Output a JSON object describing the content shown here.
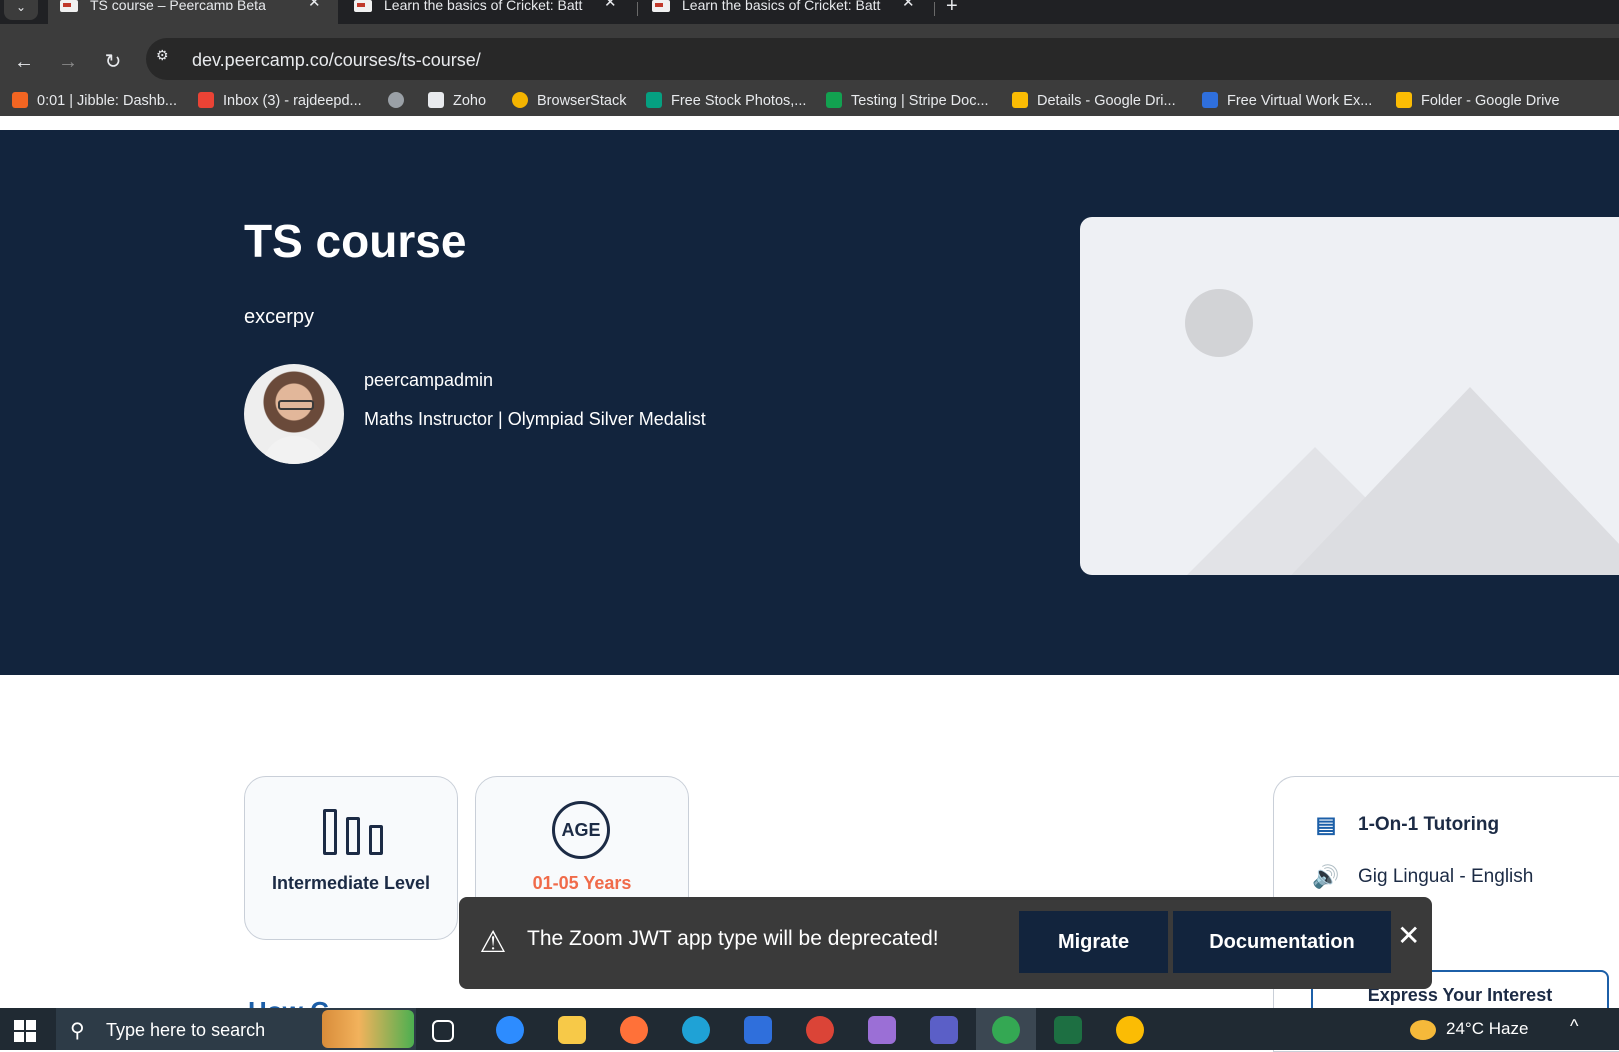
{
  "browser": {
    "tabs": [
      {
        "title": "TS course – Peercamp Beta",
        "active": true
      },
      {
        "title": "Learn the basics of Cricket: Batt",
        "active": false
      },
      {
        "title": "Learn the basics of Cricket: Batt",
        "active": false
      }
    ],
    "url": "dev.peercamp.co/courses/ts-course/",
    "bookmarks": [
      {
        "label": "0:01 | Jibble: Dashb...",
        "icon": "jibble-icon",
        "color": "#f26522"
      },
      {
        "label": "Inbox (3) - rajdeepd...",
        "icon": "gmail-icon",
        "color": "#ea4335"
      },
      {
        "label": "",
        "icon": "globe-icon",
        "color": "#9aa0a6"
      },
      {
        "label": "Zoho",
        "icon": "zoho-icon",
        "color": "#e8eaed"
      },
      {
        "label": "BrowserStack",
        "icon": "browserstack-icon",
        "color": "#f4b400"
      },
      {
        "label": "Free Stock Photos,...",
        "icon": "pexels-icon",
        "color": "#05a081"
      },
      {
        "label": "Testing | Stripe Doc...",
        "icon": "stripe-icon",
        "color": "#12a150"
      },
      {
        "label": "Details - Google Dri...",
        "icon": "google-drive-icon",
        "color": "#fbbc04"
      },
      {
        "label": "Free Virtual Work Ex...",
        "icon": "forage-icon",
        "color": "#2f6fdc"
      },
      {
        "label": "Folder - Google Drive",
        "icon": "google-drive-icon",
        "color": "#fbbc04"
      }
    ]
  },
  "course": {
    "title": "TS course",
    "excerpt": "excerpy",
    "instructor_name": "peercampadmin",
    "instructor_role": "Maths Instructor | Olympiad Silver Medalist"
  },
  "info_cards": {
    "level_label": "Intermediate Level",
    "age_icon_text": "AGE",
    "age_label": "01-05 Years"
  },
  "side_card": {
    "tutoring": "1-On-1 Tutoring",
    "language": "Gig Lingual - English",
    "express_button": "Express Your Interest"
  },
  "section_heading": "How C",
  "notice": {
    "text": "The Zoom JWT app type will be deprecated!",
    "migrate_button": "Migrate",
    "documentation_button": "Documentation"
  },
  "taskbar": {
    "search_placeholder": "Type here to search",
    "weather": "24°C  Haze"
  },
  "colors": {
    "hero_bg": "#12243d",
    "accent_orange": "#f06b4a",
    "accent_blue": "#1c5fa8"
  }
}
